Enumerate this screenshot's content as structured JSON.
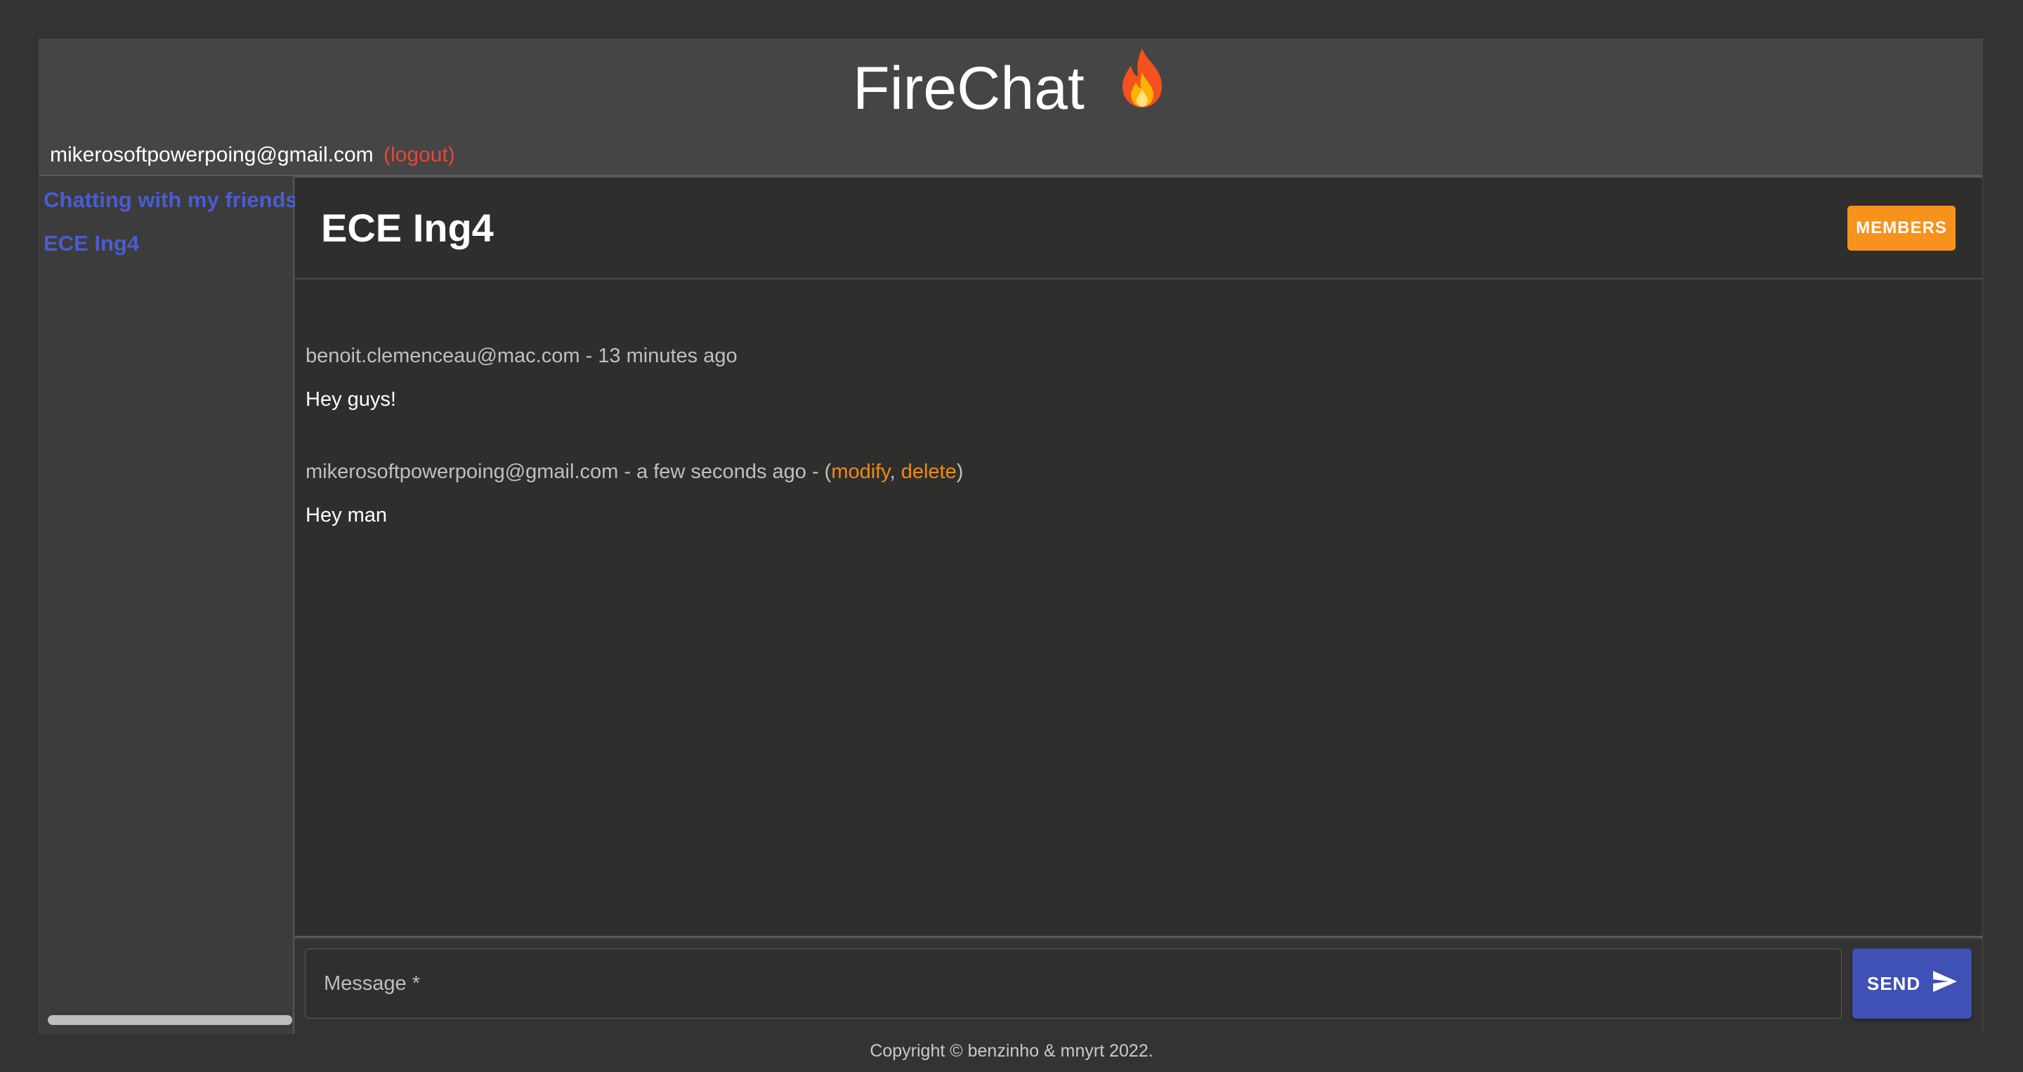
{
  "header": {
    "title": "FireChat",
    "title_emoji": "🔥",
    "user_email": "mikerosoftpowerpoing@gmail.com",
    "logout_label": "(logout)"
  },
  "sidebar": {
    "channels": [
      {
        "label": "Chatting with my friends"
      },
      {
        "label": "ECE Ing4"
      }
    ]
  },
  "channel": {
    "name": "ECE Ing4",
    "members_label": "MEMBERS"
  },
  "messages": [
    {
      "author": "benoit.clemenceau@mac.com",
      "time": "13 minutes ago",
      "text": "Hey guys!"
    },
    {
      "author": "mikerosoftpowerpoing@gmail.com",
      "time": "a few seconds ago",
      "modify_label": "modify",
      "delete_label": "delete",
      "text": "Hey man"
    }
  ],
  "composer": {
    "placeholder": "Message *",
    "send_label": "SEND"
  },
  "footer": {
    "copyright": "Copyright © benzinho & mnyrt 2022."
  },
  "colors": {
    "accent_orange": "#f7921c",
    "primary_blue": "#3f51b5",
    "link_blue": "#4a5cd0",
    "logout_red": "#e5473a"
  },
  "icons": {
    "title": "fire-icon",
    "send": "send-icon"
  }
}
